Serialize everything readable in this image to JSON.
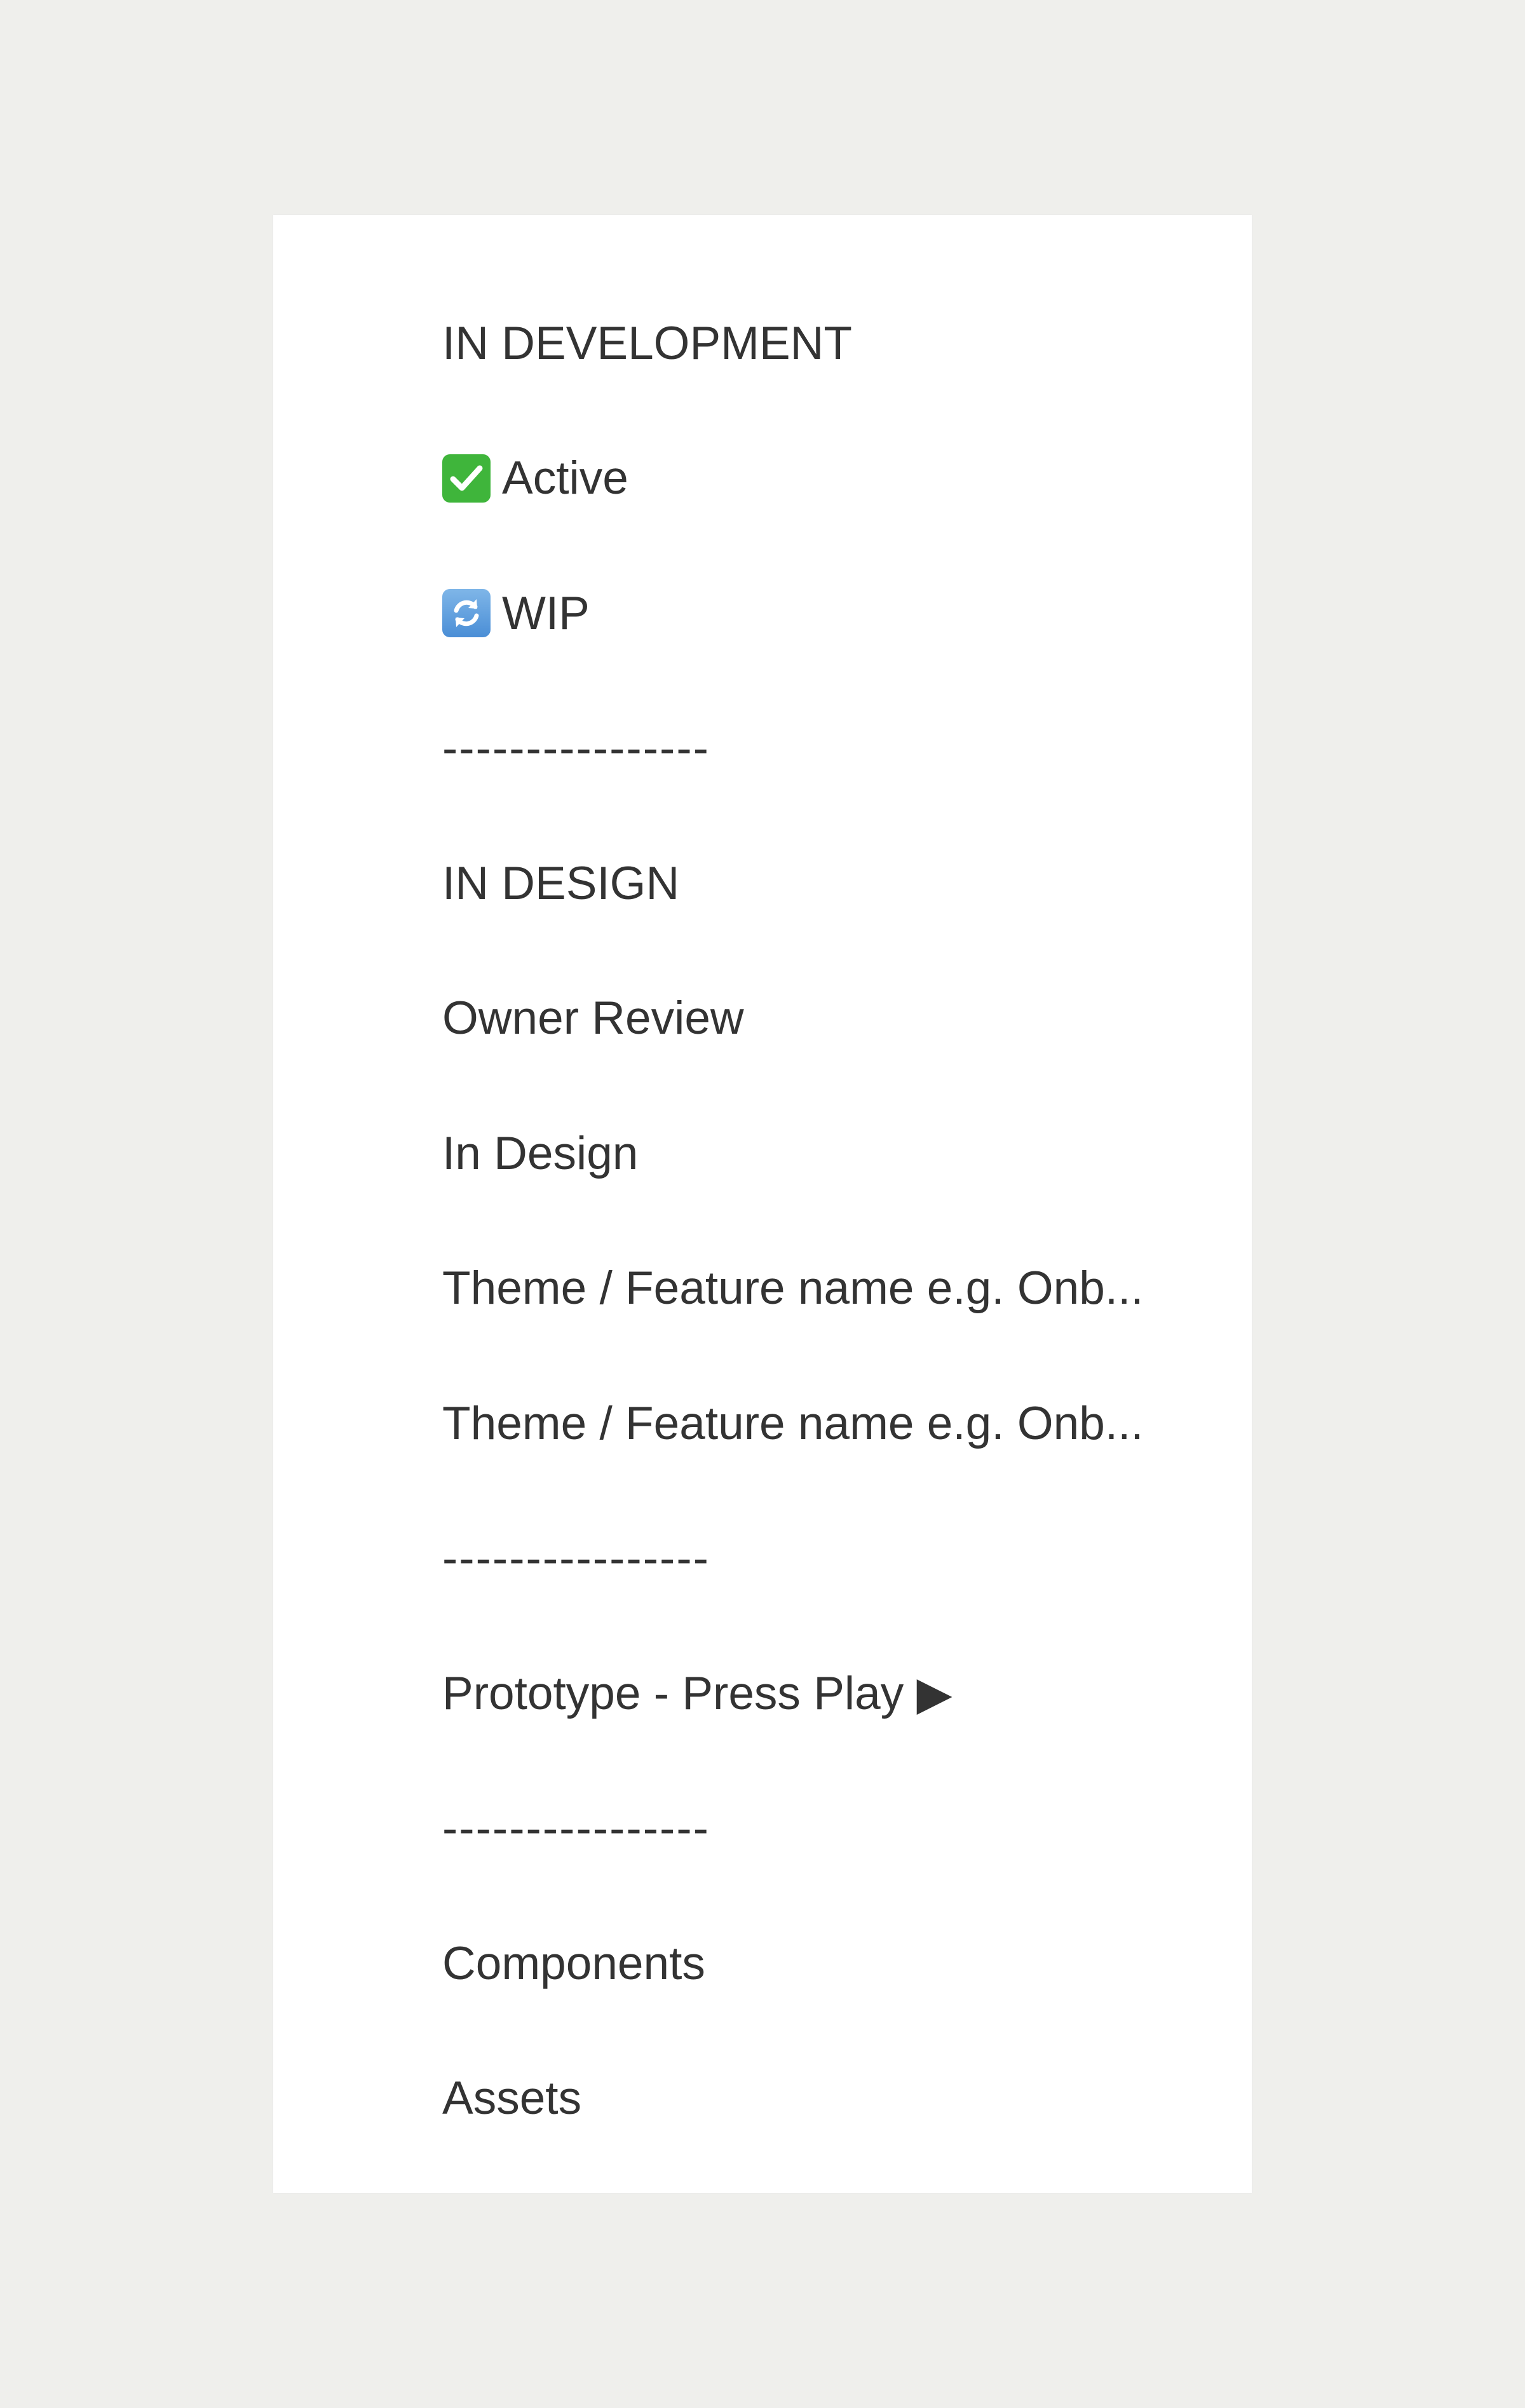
{
  "pages": [
    {
      "id": "in-development-heading",
      "label": "IN DEVELOPMENT",
      "icon": null
    },
    {
      "id": "active",
      "label": "Active",
      "icon": "check-mark-emoji-icon"
    },
    {
      "id": "wip",
      "label": "WIP",
      "icon": "refresh-emoji-icon"
    },
    {
      "id": "divider-1",
      "label": "----------------",
      "icon": null
    },
    {
      "id": "in-design-heading",
      "label": "IN DESIGN",
      "icon": null
    },
    {
      "id": "owner-review",
      "label": "Owner Review",
      "icon": null
    },
    {
      "id": "in-design",
      "label": "In Design",
      "icon": null
    },
    {
      "id": "theme-feature-1",
      "label": "Theme / Feature name e.g. Onb...",
      "icon": null
    },
    {
      "id": "theme-feature-2",
      "label": "Theme / Feature name e.g. Onb...",
      "icon": null
    },
    {
      "id": "divider-2",
      "label": "----------------",
      "icon": null
    },
    {
      "id": "prototype",
      "label": "Prototype - Press Play ▶",
      "icon": null
    },
    {
      "id": "divider-3",
      "label": "----------------",
      "icon": null
    },
    {
      "id": "components",
      "label": "Components",
      "icon": null
    },
    {
      "id": "assets",
      "label": "Assets",
      "icon": null
    }
  ],
  "colors": {
    "background": "#efefec",
    "panel": "#ffffff",
    "text": "#333333",
    "check_green": "#3fb53b",
    "refresh_blue": "#4a8ed6"
  }
}
